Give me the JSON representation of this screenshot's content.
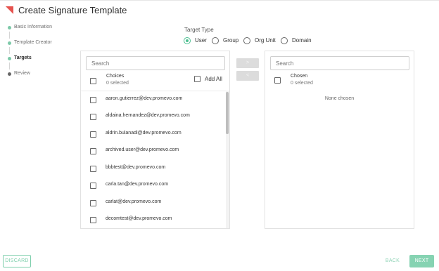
{
  "app": {
    "title": "Create Signature Template",
    "accent_color": "#4cbf91",
    "logo_color": "#e6534e"
  },
  "steps": [
    {
      "label": "Basic Information",
      "state": "done"
    },
    {
      "label": "Template Creator",
      "state": "done"
    },
    {
      "label": "Targets",
      "state": "active"
    },
    {
      "label": "Review",
      "state": "pending"
    }
  ],
  "target_type": {
    "label": "Target Type",
    "options": [
      {
        "label": "User",
        "checked": true
      },
      {
        "label": "Group",
        "checked": false
      },
      {
        "label": "Org Unit",
        "checked": false
      },
      {
        "label": "Domain",
        "checked": false
      }
    ]
  },
  "choices": {
    "search_placeholder": "Search",
    "title": "Choices",
    "selected_text": "0 selected",
    "add_all_label": "Add All",
    "items": [
      "aaron.gutierrez@dev.promevo.com",
      "aldaina.hernandez@dev.promevo.com",
      "aldrin.bulanadi@dev.promevo.com",
      "archived.user@dev.promevo.com",
      "bbbtest@dev.promevo.com",
      "carla.tan@dev.promevo.com",
      "carlat@dev.promevo.com",
      "decomtest@dev.promevo.com"
    ]
  },
  "transfer": {
    "add_label": ">",
    "remove_label": "<"
  },
  "chosen": {
    "search_placeholder": "Search",
    "title": "Chosen",
    "selected_text": "0 selected",
    "empty_text": "None chosen"
  },
  "footer": {
    "discard_label": "DISCARD",
    "back_label": "BACK",
    "next_label": "NEXT"
  }
}
